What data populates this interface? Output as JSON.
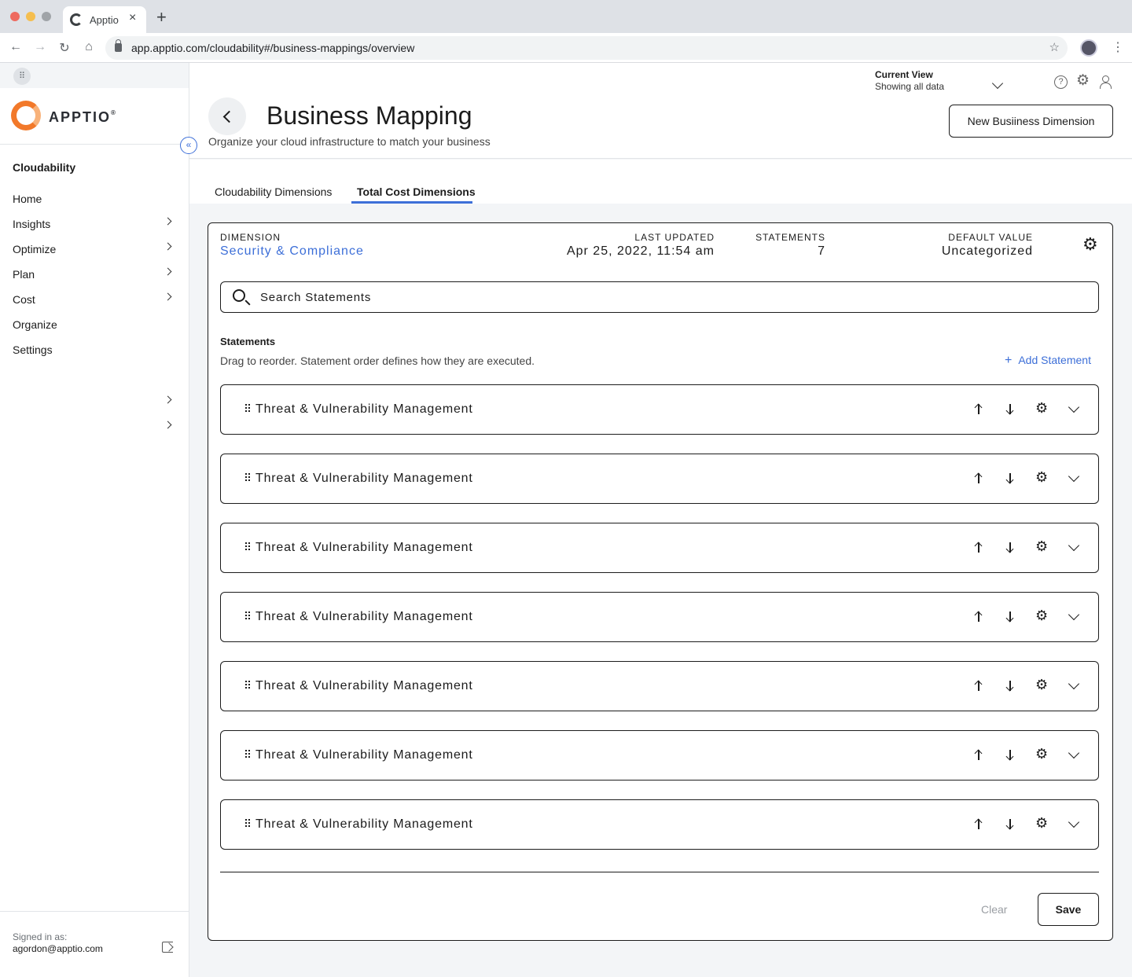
{
  "browser": {
    "tab_title": "Apptio",
    "url": "app.apptio.com/cloudability#/business-mappings/overview"
  },
  "sidebar": {
    "logo_text": "APPTIO",
    "section": "Cloudability",
    "items": [
      {
        "label": "Home",
        "has_chevron": false
      },
      {
        "label": "Insights",
        "has_chevron": true
      },
      {
        "label": "Optimize",
        "has_chevron": true
      },
      {
        "label": "Plan",
        "has_chevron": true
      },
      {
        "label": "Cost",
        "has_chevron": true
      },
      {
        "label": "Organize",
        "has_chevron": false
      },
      {
        "label": "Settings",
        "has_chevron": false
      }
    ],
    "signed_in_label": "Signed in as:",
    "signed_in_email": "agordon@apptio.com"
  },
  "header": {
    "current_view_title": "Current View",
    "current_view_value": "Showing all data",
    "title": "Business Mapping",
    "subtitle": "Organize your cloud infrastructure to match your business",
    "new_button": "New Busiiness Dimension"
  },
  "tabs": [
    {
      "label": "Cloudability Dimensions",
      "active": false
    },
    {
      "label": "Total Cost Dimensions",
      "active": true
    }
  ],
  "dimension": {
    "dimension_label": "DIMENSION",
    "dimension_value": "Security & Compliance",
    "updated_label": "LAST UPDATED",
    "updated_value": "Apr 25, 2022, 11:54 am",
    "statements_label": "STATEMENTS",
    "statements_value": "7",
    "default_label": "DEFAULT VALUE",
    "default_value": "Uncategorized"
  },
  "search": {
    "placeholder": "Search Statements"
  },
  "statements": {
    "title": "Statements",
    "description": "Drag to reorder. Statement order defines how they are executed.",
    "add_label": "Add Statement",
    "rows": [
      "Threat & Vulnerability Management",
      "Threat & Vulnerability Management",
      "Threat & Vulnerability Management",
      "Threat & Vulnerability Management",
      "Threat & Vulnerability Management",
      "Threat & Vulnerability Management",
      "Threat & Vulnerability Management"
    ]
  },
  "actions": {
    "clear": "Clear",
    "save": "Save"
  },
  "colors": {
    "accent": "#3d6fd8",
    "brand_orange": "#f2792a",
    "page_bg": "#f3f5f7"
  }
}
